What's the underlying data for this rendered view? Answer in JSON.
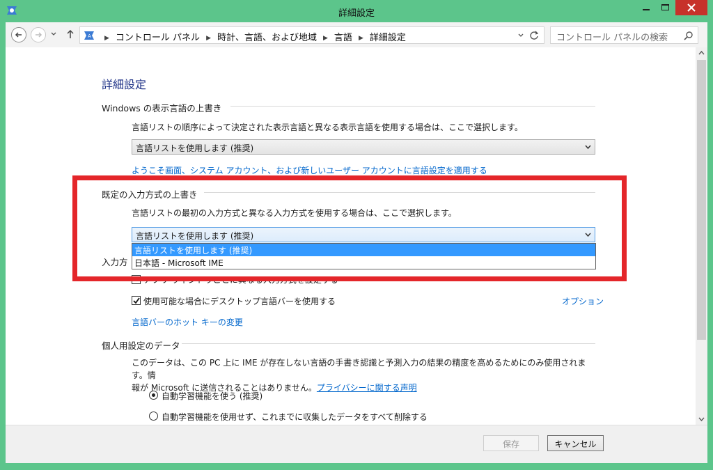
{
  "window": {
    "title": "詳細設定"
  },
  "navbar": {
    "breadcrumbs": [
      "コントロール パネル",
      "時計、言語、および地域",
      "言語",
      "詳細設定"
    ],
    "search_placeholder": "コントロール パネルの検索"
  },
  "page": {
    "title": "詳細設定",
    "display_lang": {
      "heading": "Windows の表示言語の上書き",
      "description": "言語リストの順序によって決定された表示言語と異なる表示言語を使用する場合は、ここで選択します。",
      "selected": "言語リストを使用します (推奨)",
      "apply_link": "ようこそ画面、システム アカウント、および新しいユーザー アカウントに言語設定を適用する"
    },
    "input_method": {
      "heading": "既定の入力方式の上書き",
      "description": "言語リストの最初の入力方式と異なる入力方式を使用する場合は、ここで選択します。",
      "selected": "言語リストを使用します (推奨)",
      "options": [
        "言語リストを使用します (推奨)",
        "日本語 - Microsoft IME"
      ]
    },
    "switching": {
      "heading": "入力方",
      "per_app_label": "アプリ ウィンドウごとに異なる入力方式を設定する",
      "langbar_label": "使用可能な場合にデスクトップ言語バーを使用する",
      "options_link": "オプション",
      "hotkey_link": "言語バーのホット キーの変更"
    },
    "personalization": {
      "heading": "個人用設定のデータ",
      "text_1": "このデータは、この PC 上に IME が存在しない言語の手書き認識と予測入力の結果の精度を高めるためにのみ使用されます。情",
      "text_2": "報が Microsoft に送信されることはありません。",
      "privacy_link": "プライバシーに関する声明",
      "radio_on": "自動学習機能を使う (推奨)",
      "radio_off": "自動学習機能を使用せず、これまでに収集したデータをすべて削除する"
    }
  },
  "footer": {
    "save_label": "保存",
    "cancel_label": "キャンセル"
  }
}
